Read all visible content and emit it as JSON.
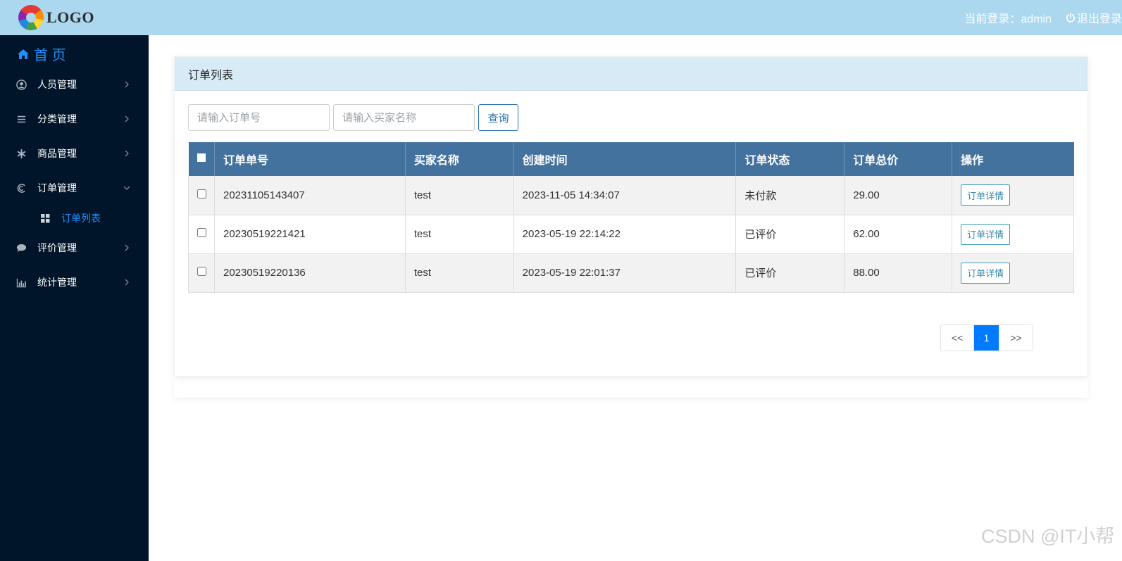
{
  "header": {
    "logo_text": "LOGO",
    "user_label": "当前登录：admin",
    "logout_label": "退出登录"
  },
  "sidebar": {
    "home_label": "首 页",
    "items": [
      {
        "label": "人员管理",
        "icon": "user-circle-icon"
      },
      {
        "label": "分类管理",
        "icon": "list-icon"
      },
      {
        "label": "商品管理",
        "icon": "asterisk-icon"
      },
      {
        "label": "订单管理",
        "icon": "order-icon",
        "expanded": true
      },
      {
        "label": "评价管理",
        "icon": "comment-icon"
      },
      {
        "label": "统计管理",
        "icon": "bar-chart-icon"
      }
    ],
    "submenu": [
      {
        "label": "订单列表",
        "icon": "grid-icon"
      }
    ]
  },
  "panel": {
    "title": "订单列表",
    "search": {
      "order_no_placeholder": "请输入订单号",
      "buyer_placeholder": "请输入买家名称",
      "query_label": "查询"
    },
    "table": {
      "columns": [
        "订单单号",
        "买家名称",
        "创建时间",
        "订单状态",
        "订单总价",
        "操作"
      ],
      "rows": [
        {
          "order_no": "20231105143407",
          "buyer": "test",
          "created": "2023-11-05 14:34:07",
          "status": "未付款",
          "total": "29.00",
          "action": "订单详情"
        },
        {
          "order_no": "20230519221421",
          "buyer": "test",
          "created": "2023-05-19 22:14:22",
          "status": "已评价",
          "total": "62.00",
          "action": "订单详情"
        },
        {
          "order_no": "20230519220136",
          "buyer": "test",
          "created": "2023-05-19 22:01:37",
          "status": "已评价",
          "total": "88.00",
          "action": "订单详情"
        }
      ]
    },
    "pagination": {
      "prev": "<<",
      "current": "1",
      "next": ">>"
    }
  },
  "watermark": "CSDN @IT小帮",
  "colors": {
    "header_bg": "#abd7ef",
    "sidebar_bg": "#001529",
    "accent": "#1e90ff",
    "table_header": "#44729f",
    "page_active": "#007bff"
  }
}
